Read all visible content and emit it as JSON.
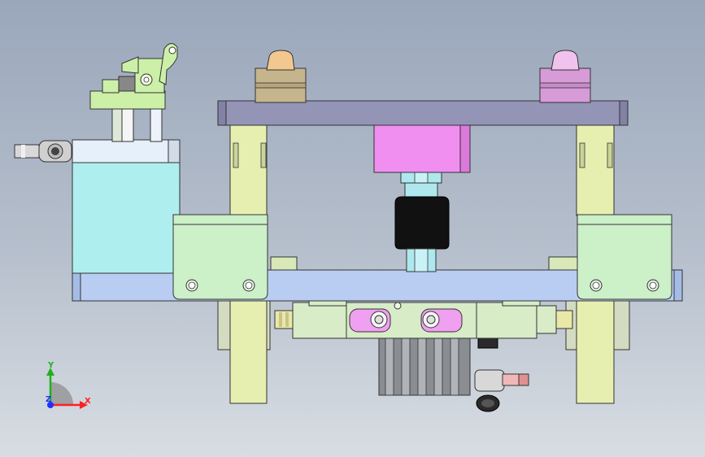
{
  "triad": {
    "x_label": "X",
    "y_label": "Y",
    "z_label": "Z",
    "x_color": "#ff2020",
    "y_color": "#20b020",
    "z_color": "#2030ff"
  },
  "part_colors": {
    "top_plate": "#9394b6",
    "base_plate": "#b9cdf3",
    "block": "#ccf0c8",
    "cylinder": "#e6efb0",
    "valve": "#d7ecc7",
    "air_cylinder": "#aeeeee",
    "pink_block": "#f08ff0",
    "nut_tan": "#c6b58c",
    "nut_purple": "#d79bd8",
    "sensor": "#111111",
    "nut_blue": "#aee8ee",
    "rail": "#b7d9b4"
  }
}
